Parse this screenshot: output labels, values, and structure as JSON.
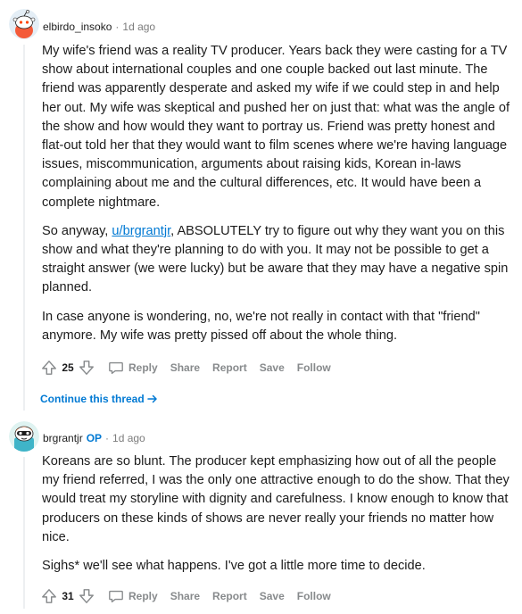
{
  "comments": [
    {
      "author": "elbirdo_insoko",
      "time": "1d ago",
      "p1": "My wife's friend was a reality TV producer. Years back they were casting for a TV show about international couples and one couple backed out last minute. The friend was apparently desperate and asked my wife if we could step in and help her out. My wife was skeptical and pushed her on just that: what was the angle of the show and how would they want to portray us. Friend was pretty honest and flat-out told her that they would want to film scenes where we're having language issues, miscommunication, arguments about raising kids, Korean in-laws complaining about me and the cultural differences, etc. It would have been a complete nightmare.",
      "p2_before": "So anyway, ",
      "p2_link": "u/brgrantjr",
      "p2_after": ", ABSOLUTELY try to figure out why they want you on this show and what they're planning to do with you. It may not be possible to get a straight answer (we were lucky) but be aware that they may have a negative spin planned.",
      "p3": "In case anyone is wondering, no, we're not really in contact with that \"friend\" anymore. My wife was pretty pissed off about the whole thing.",
      "score": "25",
      "continue_label": "Continue this thread"
    },
    {
      "author": "brgrantjr",
      "op_badge": "OP",
      "time": "1d ago",
      "p1": "Koreans are so blunt. The producer kept emphasizing how out of all the people my friend referred, I was the only one attractive enough to do the show. That they would treat my storyline with dignity and carefulness. I know enough to know that producers on these kinds of shows are never really your friends no matter how nice.",
      "p2": "Sighs* we'll see what happens. I've got a little more time to decide.",
      "score": "31"
    }
  ],
  "actions": {
    "reply": "Reply",
    "share": "Share",
    "report": "Report",
    "save": "Save",
    "follow": "Follow"
  },
  "colors": {
    "link": "#0079d3",
    "meta": "#7c7c7c",
    "action": "#878a8c"
  },
  "icons": [
    "snoo-avatar-icon",
    "upvote-icon",
    "downvote-icon",
    "reply-icon",
    "arrow-right-icon"
  ]
}
